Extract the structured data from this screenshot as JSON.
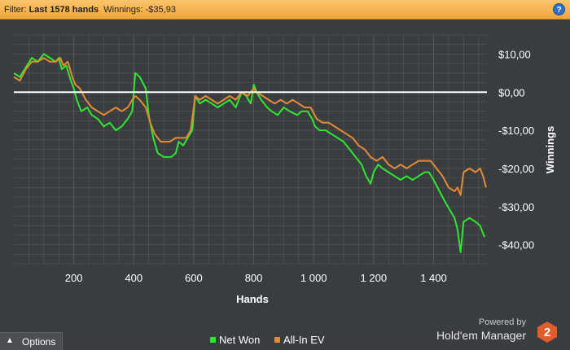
{
  "filter_bar": {
    "filter_label": "Filter:",
    "filter_value": "Last 1578 hands",
    "winnings_label": "Winnings:",
    "winnings_value": "-$35,93",
    "help_symbol": "?"
  },
  "options_button": {
    "label": "Options",
    "icon": "chevron-up-icon"
  },
  "branding": {
    "powered_by": "Powered by",
    "product": "Hold'em Manager",
    "badge": "2"
  },
  "colors": {
    "background": "#3a3d40",
    "filter_bar": "#f5b04e",
    "net_won": "#2ee82e",
    "all_in_ev": "#e58a32",
    "zero_line": "#ffffff",
    "grid": "#55595d",
    "badge": "#e25d2a"
  },
  "chart_data": {
    "type": "line",
    "xlabel": "Hands",
    "ylabel": "Winnings",
    "xlim": [
      0,
      1578
    ],
    "ylim": [
      -45,
      15
    ],
    "x_ticks": [
      200,
      400,
      600,
      800,
      1000,
      1200,
      1400
    ],
    "x_tick_labels": [
      "200",
      "400",
      "600",
      "800",
      "1 000",
      "1 200",
      "1 400"
    ],
    "y_ticks": [
      10,
      0,
      -10,
      -20,
      -30,
      -40
    ],
    "y_tick_labels": [
      "$10,00",
      "$0,00",
      "-$10,00",
      "-$20,00",
      "-$30,00",
      "-$40,00"
    ],
    "zero_line": 0,
    "grid": true,
    "legend_position": "bottom",
    "series": [
      {
        "name": "Net Won",
        "points": [
          [
            0,
            5
          ],
          [
            20,
            4
          ],
          [
            40,
            6.5
          ],
          [
            60,
            9
          ],
          [
            80,
            8
          ],
          [
            100,
            10
          ],
          [
            120,
            9
          ],
          [
            140,
            8
          ],
          [
            150,
            9
          ],
          [
            160,
            6
          ],
          [
            175,
            7
          ],
          [
            190,
            3
          ],
          [
            200,
            1
          ],
          [
            210,
            -2
          ],
          [
            225,
            -5
          ],
          [
            245,
            -4
          ],
          [
            260,
            -6
          ],
          [
            280,
            -7
          ],
          [
            300,
            -9
          ],
          [
            320,
            -8
          ],
          [
            340,
            -10
          ],
          [
            360,
            -9
          ],
          [
            380,
            -7
          ],
          [
            395,
            -5
          ],
          [
            405,
            5
          ],
          [
            420,
            4
          ],
          [
            440,
            1
          ],
          [
            450,
            -6
          ],
          [
            465,
            -12
          ],
          [
            480,
            -16
          ],
          [
            500,
            -17
          ],
          [
            525,
            -17
          ],
          [
            540,
            -16
          ],
          [
            550,
            -13
          ],
          [
            565,
            -14
          ],
          [
            580,
            -12
          ],
          [
            595,
            -10
          ],
          [
            605,
            -1
          ],
          [
            620,
            -3
          ],
          [
            640,
            -2
          ],
          [
            660,
            -3
          ],
          [
            680,
            -4
          ],
          [
            700,
            -3
          ],
          [
            720,
            -2
          ],
          [
            740,
            -4
          ],
          [
            760,
            0
          ],
          [
            775,
            -1
          ],
          [
            790,
            -3
          ],
          [
            800,
            2
          ],
          [
            810,
            0
          ],
          [
            825,
            -2
          ],
          [
            845,
            -4
          ],
          [
            860,
            -5
          ],
          [
            880,
            -6
          ],
          [
            900,
            -4
          ],
          [
            920,
            -5
          ],
          [
            945,
            -6
          ],
          [
            960,
            -5
          ],
          [
            980,
            -5
          ],
          [
            995,
            -7
          ],
          [
            1005,
            -9
          ],
          [
            1020,
            -10
          ],
          [
            1040,
            -10
          ],
          [
            1060,
            -11
          ],
          [
            1080,
            -12
          ],
          [
            1100,
            -13
          ],
          [
            1120,
            -15
          ],
          [
            1140,
            -17
          ],
          [
            1160,
            -19
          ],
          [
            1175,
            -22
          ],
          [
            1190,
            -24
          ],
          [
            1200,
            -21
          ],
          [
            1215,
            -19
          ],
          [
            1230,
            -20
          ],
          [
            1250,
            -21
          ],
          [
            1270,
            -22
          ],
          [
            1290,
            -23
          ],
          [
            1310,
            -22
          ],
          [
            1330,
            -23
          ],
          [
            1350,
            -22
          ],
          [
            1370,
            -21
          ],
          [
            1385,
            -21
          ],
          [
            1400,
            -23
          ],
          [
            1420,
            -26
          ],
          [
            1440,
            -29
          ],
          [
            1455,
            -31
          ],
          [
            1470,
            -33
          ],
          [
            1480,
            -36
          ],
          [
            1490,
            -42
          ],
          [
            1500,
            -34
          ],
          [
            1520,
            -33
          ],
          [
            1540,
            -34
          ],
          [
            1555,
            -35
          ],
          [
            1570,
            -38
          ]
        ]
      },
      {
        "name": "All-In EV",
        "points": [
          [
            0,
            4
          ],
          [
            20,
            3
          ],
          [
            40,
            6
          ],
          [
            60,
            8
          ],
          [
            80,
            8
          ],
          [
            100,
            9
          ],
          [
            120,
            8
          ],
          [
            140,
            8
          ],
          [
            155,
            9
          ],
          [
            165,
            7
          ],
          [
            180,
            8
          ],
          [
            195,
            4
          ],
          [
            205,
            2
          ],
          [
            220,
            1
          ],
          [
            240,
            -2
          ],
          [
            260,
            -4
          ],
          [
            280,
            -5
          ],
          [
            300,
            -6
          ],
          [
            320,
            -5
          ],
          [
            340,
            -4
          ],
          [
            360,
            -5
          ],
          [
            380,
            -4
          ],
          [
            395,
            -2
          ],
          [
            405,
            -1
          ],
          [
            420,
            -2
          ],
          [
            440,
            -4
          ],
          [
            455,
            -8
          ],
          [
            470,
            -11
          ],
          [
            490,
            -13
          ],
          [
            520,
            -13
          ],
          [
            540,
            -12
          ],
          [
            560,
            -12
          ],
          [
            575,
            -12
          ],
          [
            590,
            -10
          ],
          [
            605,
            -1
          ],
          [
            620,
            -2
          ],
          [
            640,
            -1
          ],
          [
            660,
            -2
          ],
          [
            680,
            -3
          ],
          [
            700,
            -2
          ],
          [
            720,
            -1
          ],
          [
            740,
            -2
          ],
          [
            760,
            0
          ],
          [
            780,
            -1
          ],
          [
            800,
            1
          ],
          [
            810,
            0
          ],
          [
            830,
            -1
          ],
          [
            850,
            -2
          ],
          [
            870,
            -3
          ],
          [
            890,
            -2
          ],
          [
            910,
            -3
          ],
          [
            930,
            -2
          ],
          [
            950,
            -3
          ],
          [
            970,
            -4
          ],
          [
            990,
            -4
          ],
          [
            1010,
            -7
          ],
          [
            1030,
            -8
          ],
          [
            1050,
            -8
          ],
          [
            1070,
            -9
          ],
          [
            1090,
            -10
          ],
          [
            1110,
            -11
          ],
          [
            1130,
            -12
          ],
          [
            1150,
            -14
          ],
          [
            1170,
            -15
          ],
          [
            1190,
            -17
          ],
          [
            1210,
            -18
          ],
          [
            1230,
            -17
          ],
          [
            1250,
            -19
          ],
          [
            1270,
            -20
          ],
          [
            1290,
            -19
          ],
          [
            1310,
            -20
          ],
          [
            1330,
            -19
          ],
          [
            1350,
            -18
          ],
          [
            1370,
            -18
          ],
          [
            1390,
            -18
          ],
          [
            1410,
            -20
          ],
          [
            1430,
            -22
          ],
          [
            1450,
            -25
          ],
          [
            1470,
            -26
          ],
          [
            1480,
            -25
          ],
          [
            1490,
            -27
          ],
          [
            1500,
            -21
          ],
          [
            1520,
            -20
          ],
          [
            1540,
            -21
          ],
          [
            1555,
            -20
          ],
          [
            1565,
            -22
          ],
          [
            1575,
            -25
          ]
        ]
      }
    ]
  }
}
